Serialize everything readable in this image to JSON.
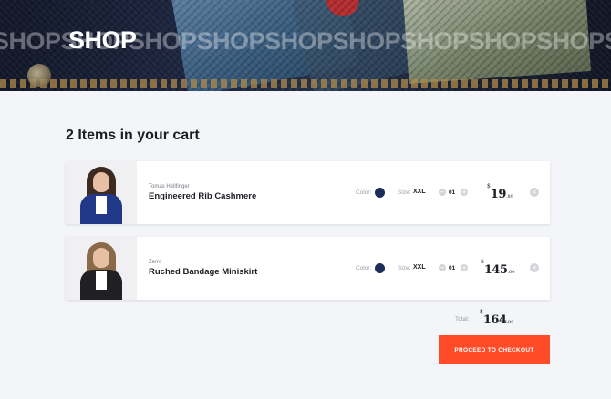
{
  "hero": {
    "title": "SHOP",
    "background_words": "SHOPSHOPSHOPSHOPSHOPSHOPSHOPSHOPSHOPSHOP"
  },
  "cart": {
    "heading": "2 Items in your cart",
    "color_label": "Color:",
    "size_label": "Size:",
    "items": [
      {
        "brand": "Tomas Hellfinger",
        "name": "Engineered Rib Cashmere",
        "color": "#1c2d5a",
        "size": "XXL",
        "quantity": "01",
        "price": {
          "currency": "$",
          "int": "19",
          "dec": ".89"
        },
        "decrement": "−",
        "increment": "+",
        "remove": "×"
      },
      {
        "brand": "Zerro",
        "name": "Ruched Bandage Miniskirt",
        "color": "#1c2d5a",
        "size": "XXL",
        "quantity": "01",
        "price": {
          "currency": "$",
          "int": "145",
          "dec": ".00"
        },
        "decrement": "−",
        "increment": "+",
        "remove": "×"
      }
    ],
    "total_label": "Total:",
    "total": {
      "currency": "$",
      "int": "164",
      "dec": ".89"
    },
    "checkout_label": "PROCEED TO CHECKOUT"
  },
  "colors": {
    "accent": "#ff4b28",
    "navy_swatch": "#1c2d5a",
    "page_background": "#f4f5f8"
  }
}
